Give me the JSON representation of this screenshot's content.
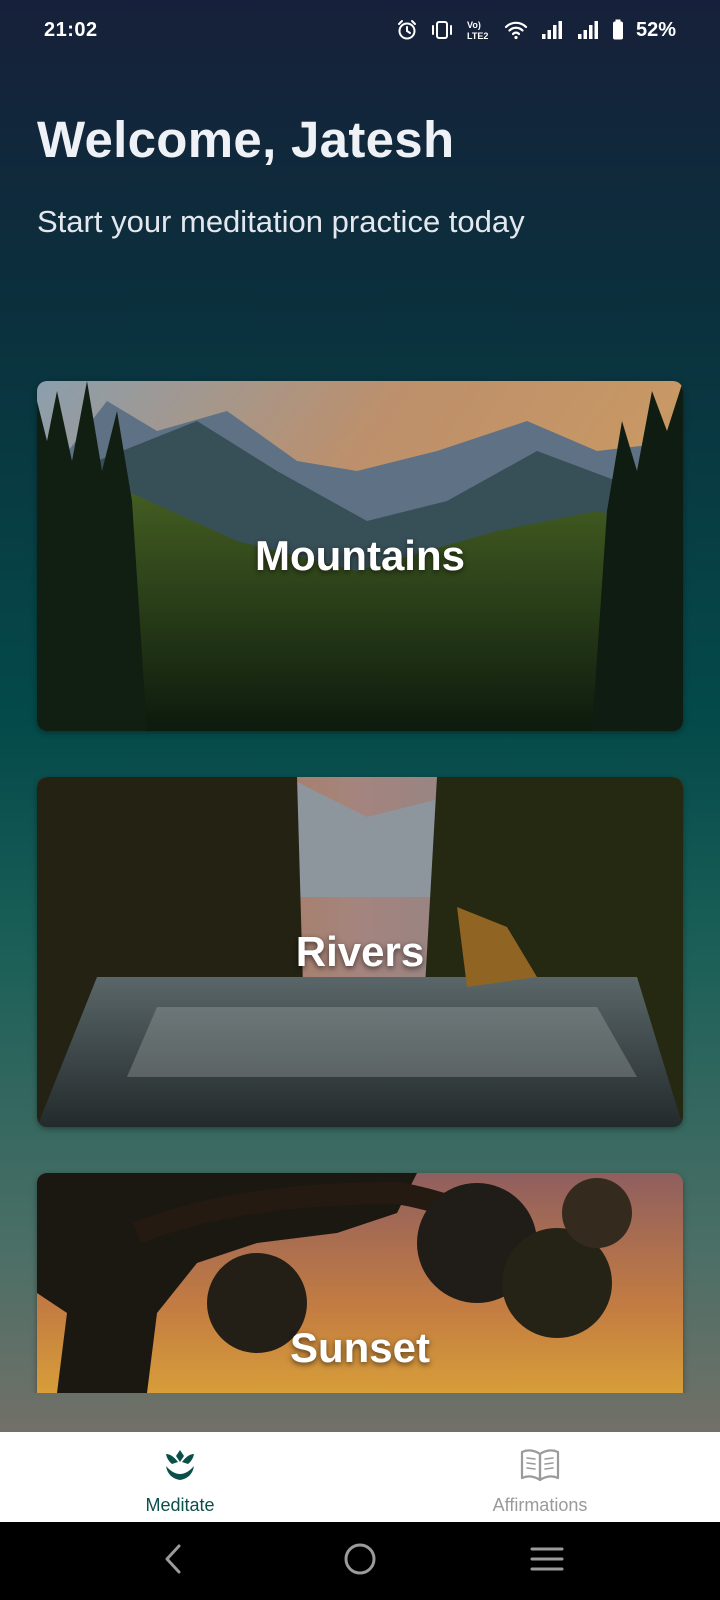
{
  "status_bar": {
    "time": "21:02",
    "battery": "52%",
    "network_label": "Vo) LTE2"
  },
  "header": {
    "welcome": "Welcome, Jatesh",
    "subtitle": "Start your meditation practice today"
  },
  "cards": [
    {
      "label": "Mountains",
      "image": "mountains-forest-sunset"
    },
    {
      "label": "Rivers",
      "image": "forest-river-sunlight"
    },
    {
      "label": "Sunset",
      "image": "tree-silhouette-sunset"
    }
  ],
  "bottom_nav": {
    "items": [
      {
        "label": "Meditate",
        "icon": "lotus-icon",
        "active": true
      },
      {
        "label": "Affirmations",
        "icon": "book-icon",
        "active": false
      }
    ]
  },
  "colors": {
    "accent": "#0a4f4a",
    "inactive": "#9a9a9a"
  }
}
